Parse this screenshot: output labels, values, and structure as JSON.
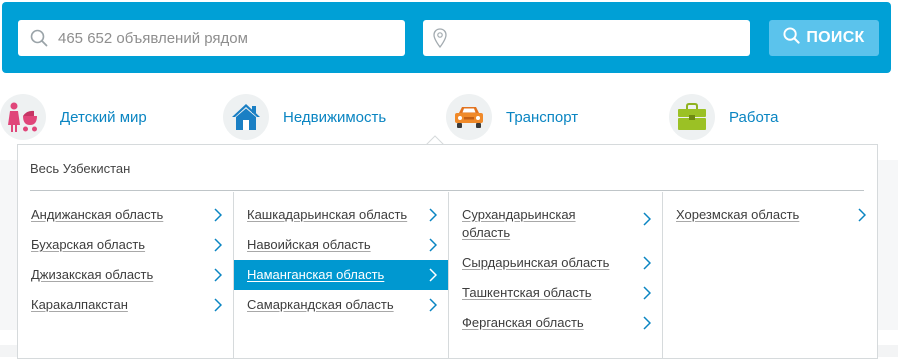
{
  "search": {
    "placeholder": "465 652 объявлений рядом",
    "location_placeholder": "",
    "button_label": "ПОИСК"
  },
  "categories": [
    {
      "label": "Детский мир",
      "icon": "stroller-mother-icon"
    },
    {
      "label": "Недвижимость",
      "icon": "house-icon"
    },
    {
      "label": "Транспорт",
      "icon": "car-icon"
    },
    {
      "label": "Работа",
      "icon": "briefcase-icon"
    }
  ],
  "region_dropdown": {
    "title": "Весь Узбекистан",
    "columns": [
      [
        "Андижанская область",
        "Бухарская область",
        "Джизакская область",
        "Каракалпакстан"
      ],
      [
        "Кашкадарьинская область",
        "Навоийская область",
        "Наманганская область",
        "Самаркандская область"
      ],
      [
        "Сурхандарьинская область",
        "Сырдарьинская область",
        "Ташкентская область",
        "Ферганская область"
      ],
      [
        "Хорезмская область"
      ]
    ],
    "highlighted": "Наманганская область"
  },
  "colors": {
    "brand": "#00a0d6",
    "button": "#5bc3ec",
    "link": "#0a85c2",
    "highlight": "#0098d0"
  }
}
